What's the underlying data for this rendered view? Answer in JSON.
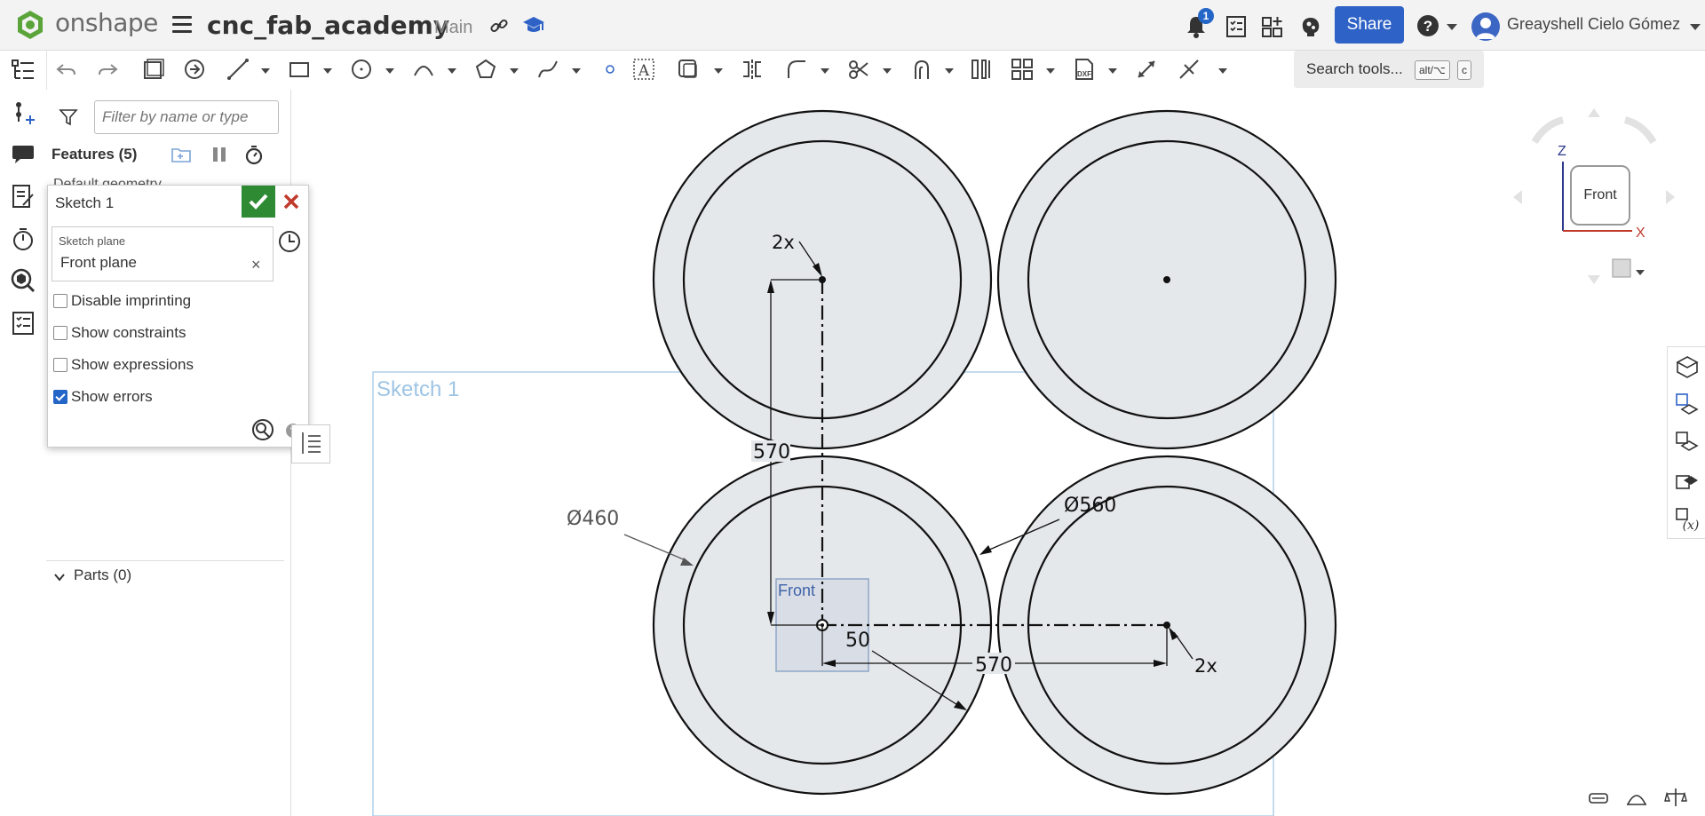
{
  "app": {
    "brand": "onshape",
    "document_title": "cnc_fab_academy",
    "branch": "Main",
    "notification_count": "1",
    "share_label": "Share",
    "user_name": "Greayshell Cielo Gómez",
    "accent_color": "#2e62c6"
  },
  "toolbar": {
    "search_label": "Search tools...",
    "shortcut_1": "alt/⌥",
    "shortcut_2": "c",
    "dxf_label": "DXF"
  },
  "features": {
    "filter_placeholder": "Filter by name or type",
    "header": "Features (5)",
    "default_geometry": "Default geometry",
    "parts": "Parts (0)"
  },
  "sketch_dialog": {
    "title": "Sketch 1",
    "plane_label": "Sketch plane",
    "plane_value": "Front plane",
    "clear_glyph": "×",
    "options": [
      {
        "label": "Disable imprinting",
        "checked": false
      },
      {
        "label": "Show constraints",
        "checked": false
      },
      {
        "label": "Show expressions",
        "checked": false
      },
      {
        "label": "Show errors",
        "checked": true
      }
    ],
    "help_glyph": "?"
  },
  "canvas": {
    "sketch_label": "Sketch 1",
    "front_plane_label": "Front",
    "dimensions": {
      "count_top": "2x",
      "count_right": "2x",
      "vertical": "570",
      "horizontal": "570",
      "diameter_inner": "Ø460",
      "diameter_outer": "Ø560",
      "offset": "50"
    }
  },
  "viewcube": {
    "face": "Front",
    "axis_z": "Z",
    "axis_x": "X"
  }
}
